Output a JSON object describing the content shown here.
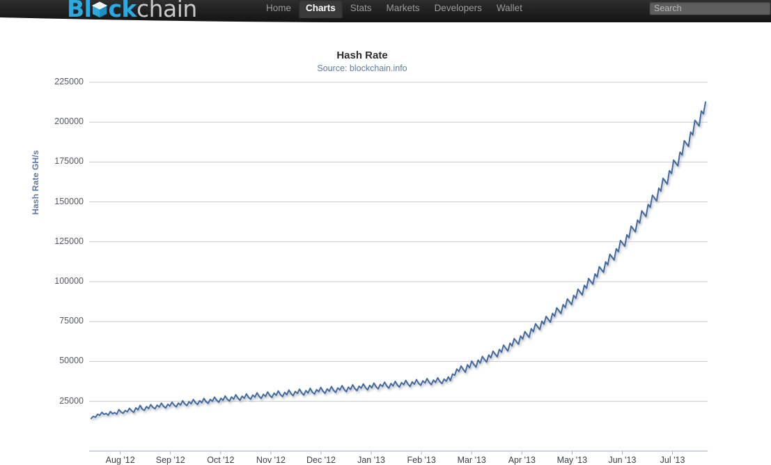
{
  "header": {
    "logo": {
      "part1": "Bl",
      "cube_icon": "cube-icon",
      "part2": "ck",
      "part3": "chain",
      "full": "Blockchain"
    },
    "nav": [
      {
        "label": "Home",
        "active": false
      },
      {
        "label": "Charts",
        "active": true
      },
      {
        "label": "Stats",
        "active": false
      },
      {
        "label": "Markets",
        "active": false
      },
      {
        "label": "Developers",
        "active": false
      },
      {
        "label": "Wallet",
        "active": false
      }
    ],
    "search": {
      "placeholder": "Search",
      "value": ""
    },
    "colors": {
      "bar_bg": "#1e1e1e",
      "logo_blue": "#29ABE2",
      "logo_grey": "#c9c9c9",
      "active_text": "#ffffff"
    }
  },
  "chart_data": {
    "type": "line",
    "title": "Hash Rate",
    "subtitle": "Source: blockchain.info",
    "xlabel": "",
    "ylabel": "Hash Rate GH/s",
    "ylim": [
      0,
      225000
    ],
    "ytick_labels": [
      "225000",
      "200000",
      "175000",
      "150000",
      "125000",
      "100000",
      "75000",
      "50000",
      "25000"
    ],
    "ytick_values": [
      225000,
      200000,
      175000,
      150000,
      125000,
      100000,
      75000,
      50000,
      25000
    ],
    "xtick_labels": [
      "Aug '12",
      "Sep '12",
      "Oct '12",
      "Nov '12",
      "Dec '12",
      "Jan '13",
      "Feb '13",
      "Mar '13",
      "Apr '13",
      "May '13",
      "Jun '13",
      "Jul '13"
    ],
    "grid": true,
    "legend": "none",
    "line_color": "#42699e",
    "series": [
      {
        "name": "Hash Rate GH/s",
        "values": [
          14200,
          15600,
          15000,
          16900,
          16200,
          18100,
          16800,
          17400,
          16300,
          18600,
          17200,
          17900,
          16900,
          19800,
          18300,
          17500,
          19200,
          18400,
          20600,
          19100,
          18000,
          20900,
          19600,
          22400,
          20100,
          19300,
          21700,
          20400,
          22900,
          21200,
          20300,
          22600,
          21400,
          23800,
          21900,
          20800,
          23100,
          22000,
          24400,
          22600,
          21500,
          23900,
          22700,
          25300,
          23400,
          22300,
          24700,
          23500,
          26100,
          24200,
          23000,
          25400,
          24100,
          26800,
          24800,
          23700,
          26200,
          25000,
          27600,
          25700,
          24400,
          26900,
          25600,
          28300,
          26300,
          25100,
          27700,
          26400,
          29100,
          27000,
          25700,
          28200,
          26900,
          29600,
          27500,
          26300,
          28900,
          27600,
          30300,
          28100,
          26800,
          29400,
          28000,
          30800,
          28700,
          27400,
          30100,
          28800,
          31500,
          29200,
          27900,
          30600,
          29100,
          32000,
          29800,
          28500,
          31200,
          29900,
          32600,
          30300,
          28900,
          31700,
          30200,
          33100,
          30800,
          29500,
          32300,
          31000,
          33700,
          31400,
          30000,
          32800,
          31300,
          34200,
          31900,
          30600,
          33400,
          32100,
          34800,
          32500,
          31000,
          33900,
          32400,
          35300,
          33000,
          31700,
          34500,
          33200,
          35900,
          33600,
          32100,
          35000,
          33500,
          36400,
          34100,
          32800,
          35600,
          34300,
          37000,
          34700,
          33200,
          36100,
          34600,
          37500,
          35200,
          33900,
          36700,
          35400,
          38100,
          35800,
          34300,
          37200,
          35700,
          38600,
          36300,
          35000,
          37800,
          36500,
          39200,
          36900,
          35400,
          38300,
          36800,
          39700,
          37400,
          36100,
          38900,
          37600,
          40300,
          38000,
          42100,
          41300,
          45200,
          43700,
          47100,
          45000,
          43200,
          47900,
          46000,
          50200,
          48100,
          46400,
          50800,
          49000,
          53100,
          51200,
          49600,
          54000,
          52300,
          56400,
          54700,
          52900,
          57500,
          55800,
          60200,
          58300,
          56500,
          61400,
          59700,
          64300,
          62500,
          60800,
          65900,
          64100,
          68700,
          66900,
          65100,
          70500,
          68700,
          73600,
          71800,
          70000,
          75200,
          73400,
          78200,
          76400,
          74600,
          80100,
          78300,
          83600,
          81800,
          80000,
          85600,
          83800,
          89200,
          87400,
          85600,
          91400,
          89600,
          95300,
          93500,
          91700,
          97700,
          95900,
          102000,
          100200,
          98400,
          104800,
          103000,
          109400,
          107600,
          105800,
          112400,
          110600,
          117200,
          115400,
          113600,
          120600,
          118800,
          125800,
          124000,
          122200,
          129400,
          127600,
          134800,
          133000,
          131200,
          138600,
          136800,
          144400,
          142600,
          140800,
          148400,
          146600,
          154200,
          152400,
          150600,
          158600,
          156800,
          164800,
          163000,
          161200,
          169600,
          167800,
          176200,
          174400,
          172600,
          181200,
          179400,
          188400,
          186600,
          184800,
          193800,
          192000,
          201200,
          199400,
          197600,
          207000,
          205200,
          212600
        ]
      }
    ]
  }
}
